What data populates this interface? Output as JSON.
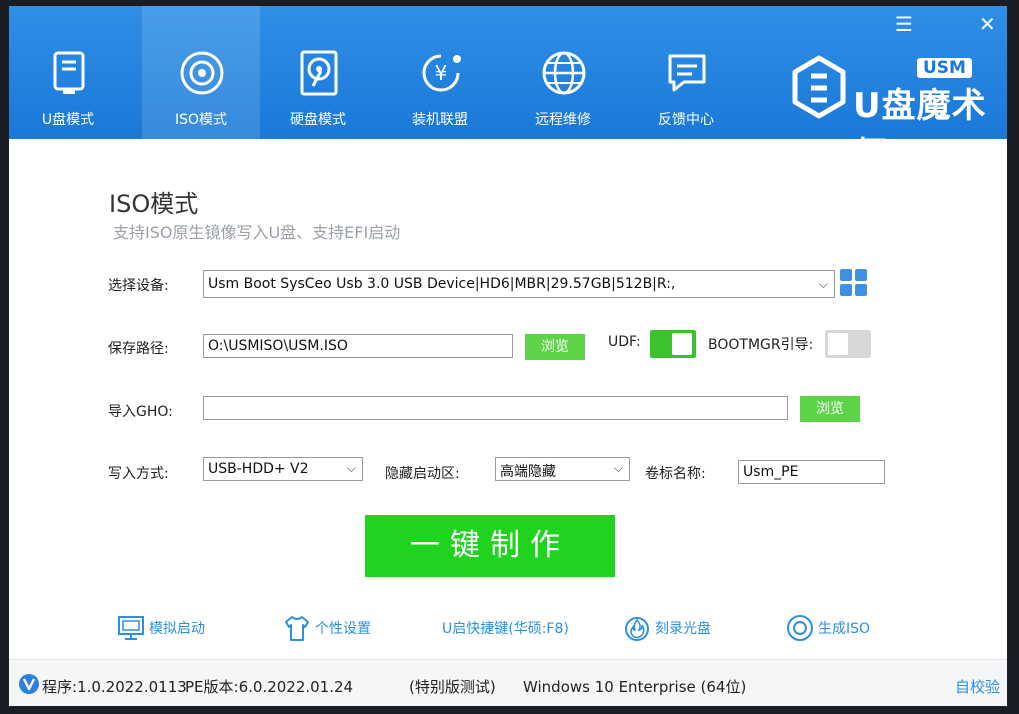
{
  "tabs": [
    {
      "label": "U盘模式",
      "icon": "usb-drive-icon"
    },
    {
      "label": "ISO模式",
      "icon": "disc-icon"
    },
    {
      "label": "硬盘模式",
      "icon": "hard-disk-icon"
    },
    {
      "label": "装机联盟",
      "icon": "yen-coin-icon"
    },
    {
      "label": "远程维修",
      "icon": "globe-icon"
    },
    {
      "label": "反馈中心",
      "icon": "chat-icon"
    }
  ],
  "active_tab": "ISO模式",
  "logo": {
    "text": "U盘魔术师",
    "badge": "USM"
  },
  "window_controls": {
    "menu": "☰",
    "close": "✕"
  },
  "page": {
    "title": "ISO模式",
    "subtitle": "支持ISO原生镜像写入U盘、支持EFI启动"
  },
  "form": {
    "device_label": "选择设备:",
    "device_value": "Usm Boot SysCeo Usb 3.0 USB Device|HD6|MBR|29.57GB|512B|R:,",
    "save_label": "保存路径:",
    "save_value": "O:\\USMISO\\USM.ISO",
    "browse_label": "浏览",
    "udf_label": "UDF:",
    "udf_on": true,
    "bootmgr_label": "BOOTMGR引导:",
    "bootmgr_on": false,
    "gho_label": "导入GHO:",
    "gho_value": "",
    "write_label": "写入方式:",
    "write_value": "USB-HDD+ V2",
    "hide_label": "隐藏启动区:",
    "hide_value": "高端隐藏",
    "volume_label": "卷标名称:",
    "volume_value": "Usm_PE"
  },
  "make_button": "一键制作",
  "tools": [
    {
      "label": "模拟启动",
      "icon": "monitor-icon"
    },
    {
      "label": "个性设置",
      "icon": "shirt-icon"
    },
    {
      "label": "U启快捷键(华硕:F8)",
      "icon": ""
    },
    {
      "label": "刻录光盘",
      "icon": "burn-disc-icon"
    },
    {
      "label": "生成ISO",
      "icon": "disc-icon"
    }
  ],
  "status": {
    "program": "程序:1.0.2022.0113",
    "pe": "PE版本:6.0.2022.01.24",
    "edition": "(特别版测试)",
    "os": "Windows 10 Enterprise (64位)",
    "selfcheck": "自校验"
  },
  "colors": {
    "header": "#1a78d8",
    "accent_green": "#1fd31e",
    "browse_green": "#5dd447",
    "link_blue": "#2d8fe0"
  }
}
